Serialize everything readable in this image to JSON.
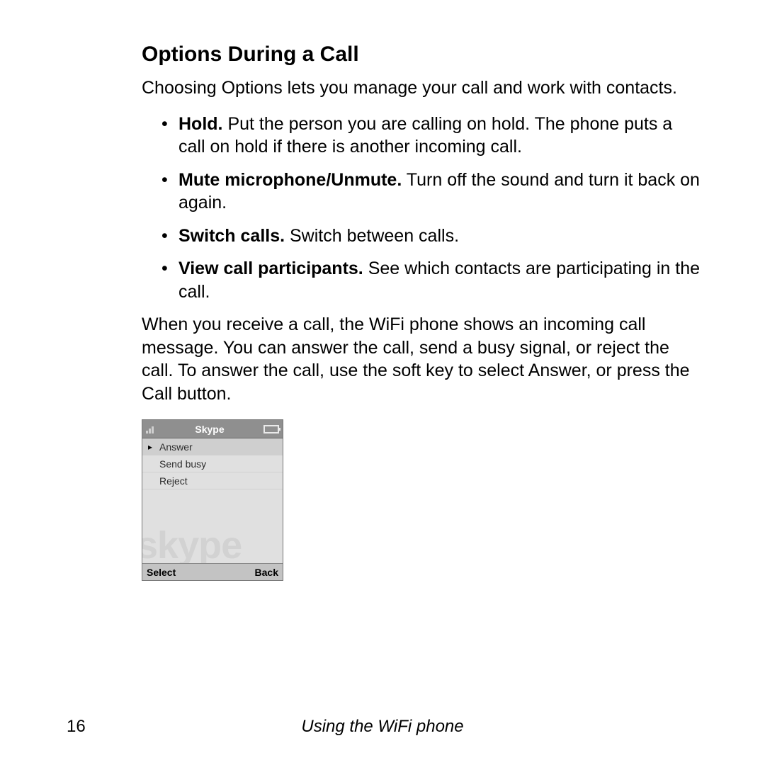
{
  "section": {
    "title": "Options During a Call",
    "intro": "Choosing Options lets you manage your call and work with contacts.",
    "options": [
      {
        "term": "Hold.",
        "desc": " Put the person you are calling on hold. The phone puts a call on hold if there is another incoming call."
      },
      {
        "term": "Mute microphone/Unmute.",
        "desc": " Turn off the sound and turn it back on again."
      },
      {
        "term": "Switch calls.",
        "desc": " Switch between calls."
      },
      {
        "term": "View call participants.",
        "desc": " See which contacts are participating in the call."
      }
    ],
    "para": "When you receive a call, the WiFi phone shows an incoming call message. You can answer the call, send a busy signal, or reject the call. To answer the call, use the soft key to select Answer, or press the Call button."
  },
  "phone": {
    "title": "Skype",
    "items": [
      "Answer",
      "Send busy",
      "Reject"
    ],
    "softkeys": {
      "left": "Select",
      "right": "Back"
    }
  },
  "footer": {
    "page": "16",
    "chapter": "Using the WiFi phone"
  }
}
